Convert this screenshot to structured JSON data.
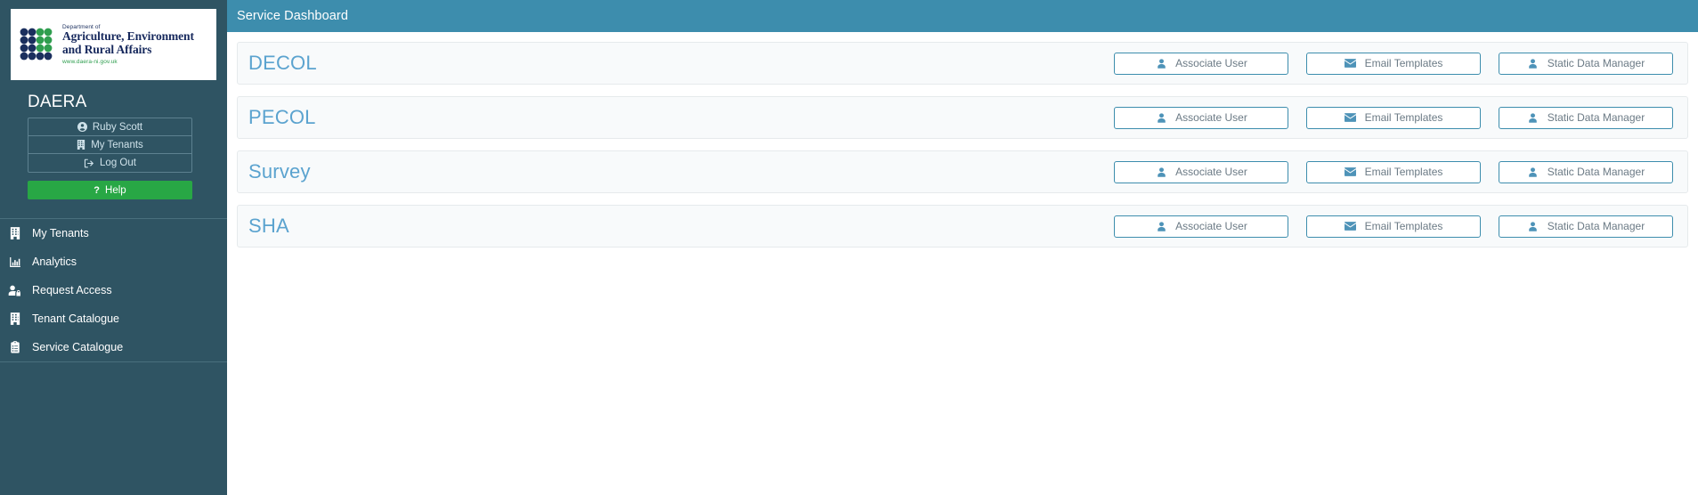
{
  "sidebar": {
    "logo": {
      "department_line": "Department of",
      "name_line1": "Agriculture, Environment",
      "name_line2": "and Rural Affairs",
      "url": "www.daera-ni.gov.uk",
      "navy": "#1b2f5e",
      "green": "#2f9e4f"
    },
    "brand_title": "DAERA",
    "user_menu": [
      {
        "label": "Ruby Scott",
        "icon": "user-circle-icon"
      },
      {
        "label": "My Tenants",
        "icon": "building-icon"
      },
      {
        "label": "Log Out",
        "icon": "sign-out-icon"
      }
    ],
    "help_button": {
      "label": "Help",
      "icon": "question-mark-icon",
      "color": "#28a745"
    },
    "nav_items": [
      {
        "label": "My Tenants",
        "icon": "building-icon"
      },
      {
        "label": "Analytics",
        "icon": "chart-bar-icon"
      },
      {
        "label": "Request Access",
        "icon": "user-lock-icon"
      },
      {
        "label": "Tenant Catalogue",
        "icon": "building-icon"
      },
      {
        "label": "Service Catalogue",
        "icon": "clipboard-list-icon"
      }
    ],
    "background_color": "#2f5463"
  },
  "header": {
    "title": "Service Dashboard",
    "background_color": "#3d8dad"
  },
  "main": {
    "button_labels": {
      "associate_user": "Associate User",
      "email_templates": "Email Templates",
      "static_data_manager": "Static Data Manager"
    },
    "services": [
      {
        "title": "DECOL"
      },
      {
        "title": "PECOL"
      },
      {
        "title": "Survey"
      },
      {
        "title": "SHA"
      }
    ],
    "title_color": "#5ba3cf",
    "button_border_color": "#3d8dad"
  }
}
